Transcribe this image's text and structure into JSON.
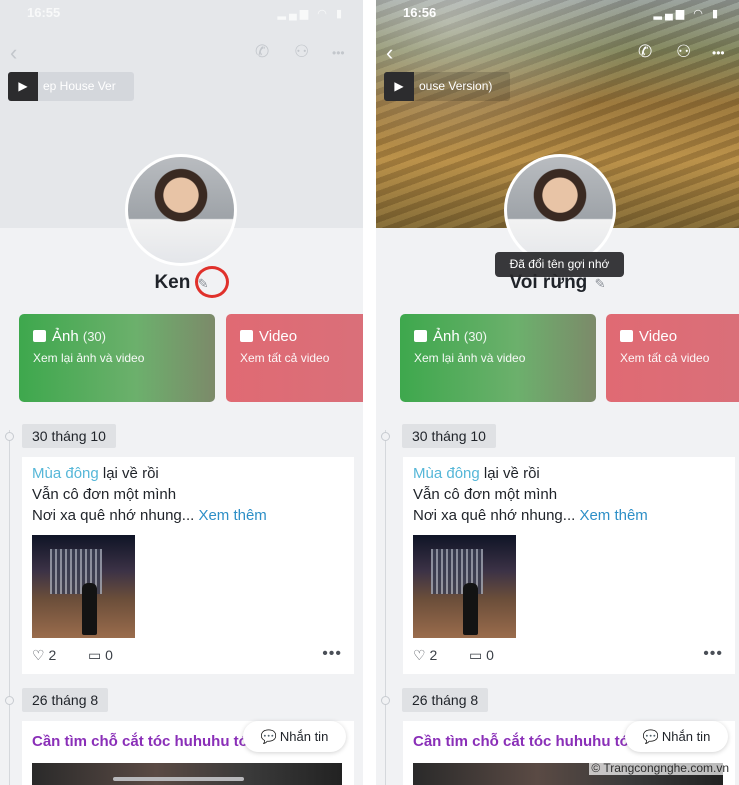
{
  "panels": [
    {
      "time": "16:55",
      "music_text": "ep House Ver",
      "profile_name": "Ken",
      "tooltip": ""
    },
    {
      "time": "16:56",
      "music_text": "ouse Version)",
      "profile_name": "Voi rừng",
      "tooltip": "Đã đổi tên gợi nhớ"
    }
  ],
  "status_icons": "▂▄▆ ◠ ▮",
  "nav": {
    "back": "‹",
    "call": "✆",
    "add_friend": "⚇",
    "more": "•••"
  },
  "cards": {
    "photo": {
      "title": "Ảnh",
      "count": "(30)",
      "subtitle": "Xem lại ảnh và video"
    },
    "video": {
      "title": "Video",
      "subtitle": "Xem tất cả video"
    }
  },
  "timeline": [
    {
      "date": "30 tháng 10",
      "line1_highlight": "Mùa đông",
      "line1_rest": " lại về rồi",
      "line2": "Vẫn cô đơn một mình",
      "line3": "Nơi xa quê nhớ nhung...",
      "see_more": " Xem thêm",
      "likes": "2",
      "comments": "0",
      "dots": "•••"
    },
    {
      "date": "26 tháng 8",
      "title": "Cần tìm chỗ cắt tóc huhuhu tó"
    }
  ],
  "message_button": "Nhắn tin",
  "watermark": "© Trangcongnghe.com.vn",
  "icons": {
    "play": "▶",
    "heart": "♡",
    "comment": "▭",
    "edit": "✎",
    "chat": "💬"
  },
  "colors": {
    "photo_card": "#3ea84d",
    "video_card": "#e06a73",
    "highlight": "#56b7d8",
    "link": "#2d8fc7",
    "post_title": "#8a2fb8",
    "annotation_circle": "#e0312b"
  }
}
